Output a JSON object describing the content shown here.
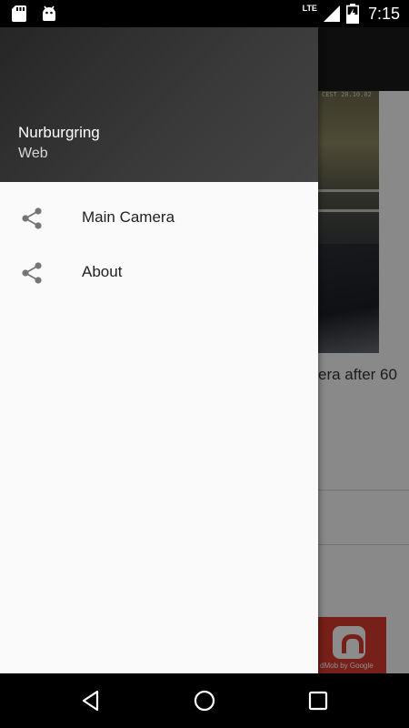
{
  "status_bar": {
    "time": "7:15",
    "network": "LTE",
    "icons": [
      "sd-card-icon",
      "android-icon",
      "signal-icon",
      "battery-charging-icon"
    ]
  },
  "background": {
    "camera_stamp": "CEST 20.10.02",
    "text_fragment": "era after 60",
    "ad_text": "dMob by Google"
  },
  "drawer": {
    "title": "Nurburgring",
    "subtitle": "Web",
    "items": [
      {
        "label": "Main Camera",
        "icon": "share-icon"
      },
      {
        "label": "About",
        "icon": "share-icon"
      }
    ]
  },
  "nav_bar": {
    "buttons": [
      "back-icon",
      "home-icon",
      "recents-icon"
    ]
  }
}
